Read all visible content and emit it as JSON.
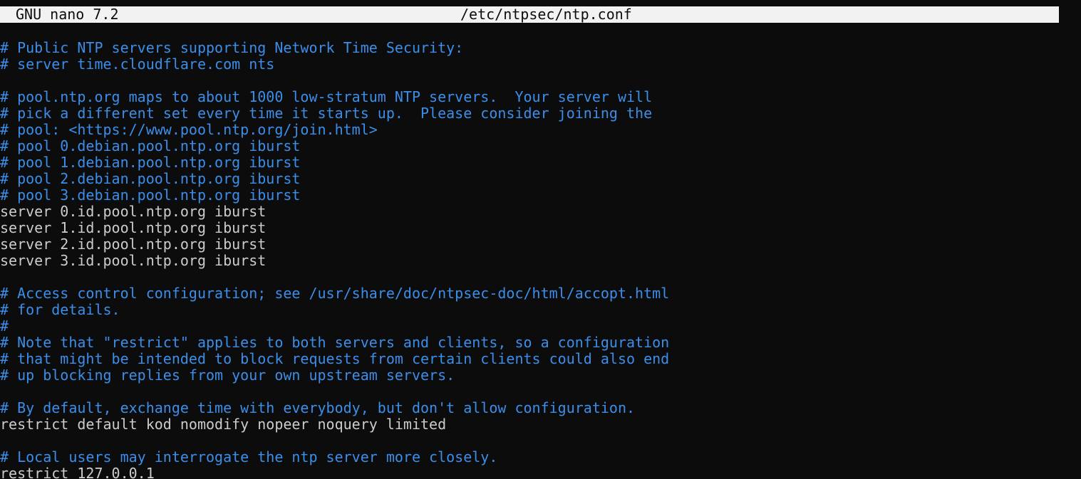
{
  "titlebar": {
    "app_name": "GNU nano 7.2",
    "file_path": "/etc/ntpsec/ntp.conf"
  },
  "lines": [
    {
      "kind": "comment",
      "text": "# Public NTP servers supporting Network Time Security:"
    },
    {
      "kind": "comment",
      "text": "# server time.cloudflare.com nts"
    },
    {
      "kind": "blank",
      "text": ""
    },
    {
      "kind": "comment",
      "text": "# pool.ntp.org maps to about 1000 low-stratum NTP servers.  Your server will"
    },
    {
      "kind": "comment",
      "text": "# pick a different set every time it starts up.  Please consider joining the"
    },
    {
      "kind": "comment",
      "text": "# pool: <https://www.pool.ntp.org/join.html>"
    },
    {
      "kind": "comment",
      "text": "# pool 0.debian.pool.ntp.org iburst"
    },
    {
      "kind": "comment",
      "text": "# pool 1.debian.pool.ntp.org iburst"
    },
    {
      "kind": "comment",
      "text": "# pool 2.debian.pool.ntp.org iburst"
    },
    {
      "kind": "comment",
      "text": "# pool 3.debian.pool.ntp.org iburst"
    },
    {
      "kind": "code",
      "text": "server 0.id.pool.ntp.org iburst"
    },
    {
      "kind": "code",
      "text": "server 1.id.pool.ntp.org iburst"
    },
    {
      "kind": "code",
      "text": "server 2.id.pool.ntp.org iburst"
    },
    {
      "kind": "code",
      "text": "server 3.id.pool.ntp.org iburst"
    },
    {
      "kind": "blank",
      "text": ""
    },
    {
      "kind": "comment",
      "text": "# Access control configuration; see /usr/share/doc/ntpsec-doc/html/accopt.html"
    },
    {
      "kind": "comment",
      "text": "# for details."
    },
    {
      "kind": "comment",
      "text": "#"
    },
    {
      "kind": "comment",
      "text": "# Note that \"restrict\" applies to both servers and clients, so a configuration"
    },
    {
      "kind": "comment",
      "text": "# that might be intended to block requests from certain clients could also end"
    },
    {
      "kind": "comment",
      "text": "# up blocking replies from your own upstream servers."
    },
    {
      "kind": "blank",
      "text": ""
    },
    {
      "kind": "comment",
      "text": "# By default, exchange time with everybody, but don't allow configuration."
    },
    {
      "kind": "code",
      "text": "restrict default kod nomodify nopeer noquery limited"
    },
    {
      "kind": "blank",
      "text": ""
    },
    {
      "kind": "comment",
      "text": "# Local users may interrogate the ntp server more closely."
    },
    {
      "kind": "code",
      "text": "restrict 127.0.0.1"
    }
  ],
  "colors": {
    "background": "#0c0c0c",
    "titlebar_bg": "#f2f2f2",
    "comment": "#3b8eea",
    "code": "#cccccc"
  }
}
